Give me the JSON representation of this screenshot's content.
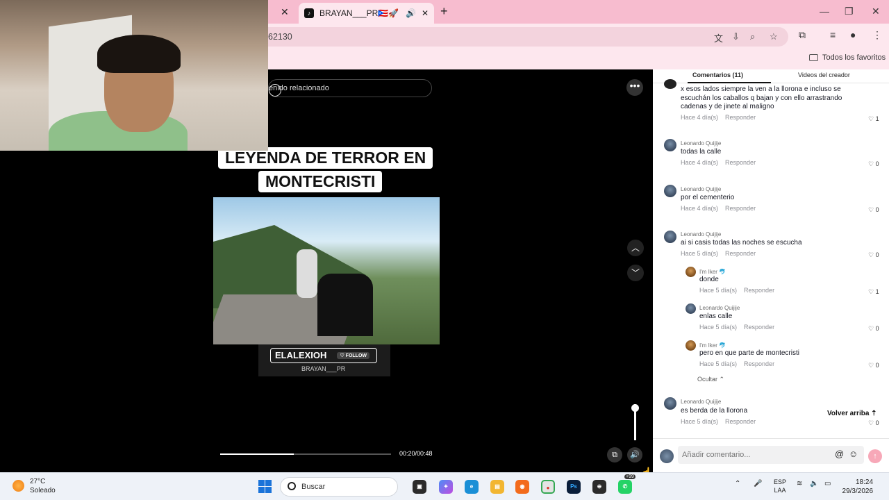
{
  "browser": {
    "prev_tab_close": "✕",
    "active_tab_title": "BRAYAN___PR🇵🇷🚀 (@elbr",
    "tab_add": "+",
    "url_fragment": "62130",
    "bookmarks_folder": "Todos los favoritos"
  },
  "video": {
    "search_placeholder": "enido relacionado",
    "caption_line1": "LEYENDA DE TERROR EN",
    "caption_line2": "MONTECRISTI",
    "brand_name": "ELALEXIOH",
    "follow_label": "♡ FOLLOW",
    "handle": "BRAYAN___PR",
    "timecode": "00:20/00:48",
    "progress_fraction": 0.43,
    "volume_fraction": 1.0
  },
  "comments_panel": {
    "tab_comments": "Comentarios (11)",
    "tab_creator_videos": "Videos del creador",
    "reply_label": "Responder",
    "hide_label": "Ocultar",
    "back_to_top": "Volver arriba",
    "input_placeholder": "Añadir comentario...",
    "comments": [
      {
        "author": "",
        "text": "x esos lados siempre la ven a la llorona e incluso se escuchán los caballos q bajan y con ello arrastrando cadenas y de jinete al maligno",
        "time": "Hace 4 día(s)",
        "likes": "1"
      },
      {
        "author": "Leonardo Quijije",
        "text": "todas la calle",
        "time": "Hace 4 día(s)",
        "likes": "0"
      },
      {
        "author": "Leonardo Quijije",
        "text": "por el cementerio",
        "time": "Hace 4 día(s)",
        "likes": "0"
      },
      {
        "author": "Leonardo Quijije",
        "text": "ai si casis todas las noches se escucha",
        "time": "Hace 5 día(s)",
        "likes": "0"
      },
      {
        "author": "I'm Iker 🐬",
        "text": "donde",
        "time": "Hace 5 día(s)",
        "likes": "1"
      },
      {
        "author": "Leonardo Quijije",
        "text": "enlas calle",
        "time": "Hace 5 día(s)",
        "likes": "0"
      },
      {
        "author": "I'm Iker 🐬",
        "text": "pero en que parte de montecristi",
        "time": "Hace 5 día(s)",
        "likes": "0"
      },
      {
        "author": "Leonardo Quijije",
        "text": "es berda de la llorona",
        "time": "Hace 5 día(s)",
        "likes": "0"
      }
    ]
  },
  "taskbar": {
    "temperature": "27°C",
    "condition": "Soleado",
    "search_label": "Buscar",
    "lang_line1": "ESP",
    "lang_line2": "LAA",
    "time": "18:24",
    "date": "29/3/2026",
    "whatsapp_badge": "+99"
  },
  "colors": {
    "tabbar_bg": "#f7bccf",
    "chrome_bg": "#fde7ee",
    "send_button": "#f7a8b8"
  }
}
